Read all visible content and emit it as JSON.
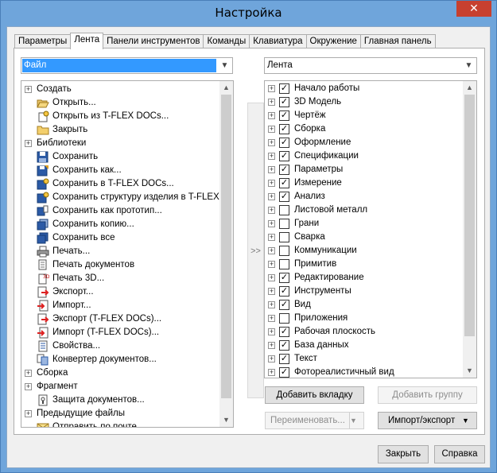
{
  "window": {
    "title": "Настройка",
    "close_glyph": "✕"
  },
  "tabs": [
    {
      "label": "Параметры"
    },
    {
      "label": "Лента",
      "active": true
    },
    {
      "label": "Панели инструментов"
    },
    {
      "label": "Команды"
    },
    {
      "label": "Клавиатура"
    },
    {
      "label": "Окружение"
    },
    {
      "label": "Главная панель"
    }
  ],
  "left_combo": {
    "value": "Файл"
  },
  "right_combo": {
    "value": "Лента"
  },
  "commands": [
    {
      "label": "Создать",
      "expander": true,
      "icon": ""
    },
    {
      "label": "Открыть...",
      "icon": "folder-open-icon"
    },
    {
      "label": "Открыть из T-FLEX DOCs...",
      "icon": "docs-open-icon"
    },
    {
      "label": "Закрыть",
      "icon": "folder-icon"
    },
    {
      "label": "Библиотеки",
      "expander": true,
      "icon": ""
    },
    {
      "label": "Сохранить",
      "icon": "save-icon"
    },
    {
      "label": "Сохранить как...",
      "icon": "save-as-icon"
    },
    {
      "label": "Сохранить в T-FLEX DOCs...",
      "icon": "save-docs-icon"
    },
    {
      "label": "Сохранить структуру изделия в T-FLEX DOCs...",
      "icon": "save-structure-icon"
    },
    {
      "label": "Сохранить как прототип...",
      "icon": "save-prototype-icon"
    },
    {
      "label": "Сохранить копию...",
      "icon": "save-copy-icon"
    },
    {
      "label": "Сохранить все",
      "icon": "save-all-icon"
    },
    {
      "label": "Печать...",
      "icon": "print-icon"
    },
    {
      "label": "Печать документов",
      "icon": "print-documents-icon"
    },
    {
      "label": "Печать 3D...",
      "icon": "print-3d-icon"
    },
    {
      "label": "Экспорт...",
      "icon": "export-icon"
    },
    {
      "label": "Импорт...",
      "icon": "import-icon"
    },
    {
      "label": "Экспорт (T-FLEX DOCs)...",
      "icon": "export-docs-icon"
    },
    {
      "label": "Импорт (T-FLEX DOCs)...",
      "icon": "import-docs-icon"
    },
    {
      "label": "Свойства...",
      "icon": "properties-icon"
    },
    {
      "label": "Конвертер документов...",
      "icon": "converter-icon"
    },
    {
      "label": "Сборка",
      "expander": true,
      "icon": ""
    },
    {
      "label": "Фрагмент",
      "expander": true,
      "icon": ""
    },
    {
      "label": "Защита документов...",
      "icon": "protect-icon"
    },
    {
      "label": "Предыдущие файлы",
      "expander": true,
      "icon": ""
    },
    {
      "label": "Отправить по почте",
      "icon": "mail-icon"
    }
  ],
  "ribbon_tabs": [
    {
      "label": "Начало работы",
      "checked": true
    },
    {
      "label": "3D Модель",
      "checked": true
    },
    {
      "label": "Чертёж",
      "checked": true
    },
    {
      "label": "Сборка",
      "checked": true
    },
    {
      "label": "Оформление",
      "checked": true
    },
    {
      "label": "Спецификации",
      "checked": true
    },
    {
      "label": "Параметры",
      "checked": true
    },
    {
      "label": "Измерение",
      "checked": true
    },
    {
      "label": "Анализ",
      "checked": true
    },
    {
      "label": "Листовой металл",
      "checked": false
    },
    {
      "label": "Грани",
      "checked": false
    },
    {
      "label": "Сварка",
      "checked": false
    },
    {
      "label": "Коммуникации",
      "checked": false
    },
    {
      "label": "Примитив",
      "checked": false
    },
    {
      "label": "Редактирование",
      "checked": true
    },
    {
      "label": "Инструменты",
      "checked": true
    },
    {
      "label": "Вид",
      "checked": true
    },
    {
      "label": "Приложения",
      "checked": false
    },
    {
      "label": "Рабочая плоскость",
      "checked": true
    },
    {
      "label": "База данных",
      "checked": true
    },
    {
      "label": "Текст",
      "checked": true
    },
    {
      "label": "Фотореалистичный вид",
      "checked": true
    }
  ],
  "move_button": {
    "label": ">>"
  },
  "buttons": {
    "add_tab": "Добавить вкладку",
    "add_group": "Добавить группу",
    "rename": "Переименовать...",
    "import_export": "Импорт/экспорт",
    "close": "Закрыть",
    "help": "Справка"
  },
  "colors": {
    "selection": "#3399ff",
    "title_bar": "#6fa5db",
    "close_button": "#c7402f"
  }
}
